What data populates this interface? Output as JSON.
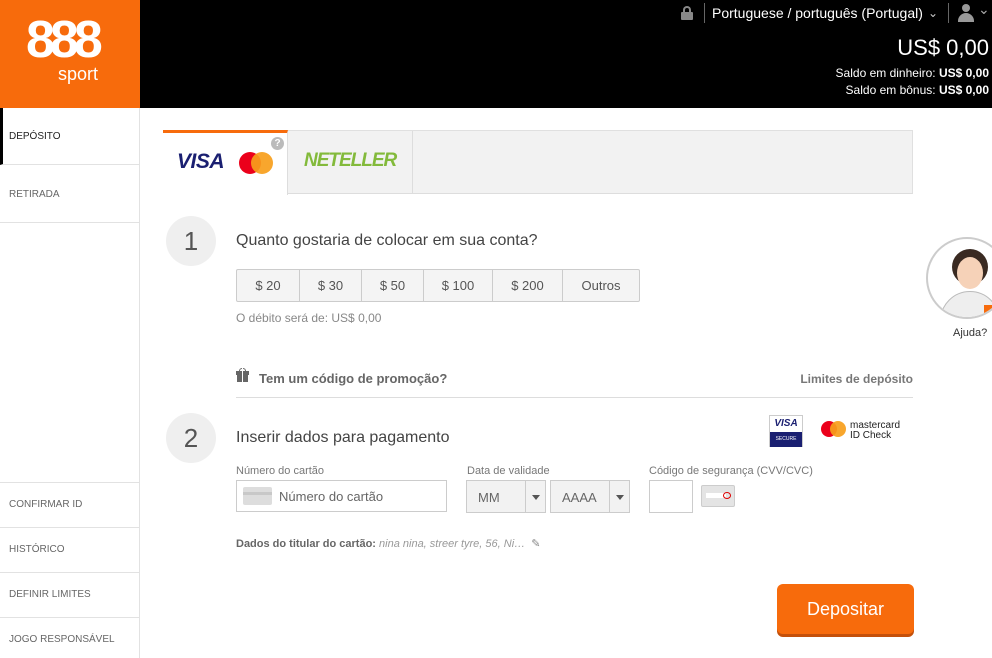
{
  "brand": {
    "logo_number": "888",
    "logo_sub": "sport",
    "accent_color": "#f76b0c"
  },
  "header": {
    "language": "Portuguese / português (Portugal)",
    "balance": "US$ 0,00",
    "cash_label": "Saldo em dinheiro:",
    "cash_value": "US$ 0,00",
    "bonus_label": "Saldo em bônus:",
    "bonus_value": "US$ 0,00"
  },
  "sidebar": {
    "items": [
      {
        "label": "DEPÓSITO",
        "active": true
      },
      {
        "label": "RETIRADA",
        "active": false
      }
    ],
    "lower": [
      {
        "label": "CONFIRMAR ID"
      },
      {
        "label": "HISTÓRICO"
      },
      {
        "label": "DEFINIR LIMITES"
      },
      {
        "label": "JOGO RESPONSÁVEL"
      }
    ]
  },
  "tabs": {
    "visa_label": "VISA",
    "help_glyph": "?",
    "neteller_label": "NETELLER"
  },
  "step1": {
    "number": "1",
    "title": "Quanto gostaria de colocar em sua conta?",
    "amounts": [
      "$ 20",
      "$ 30",
      "$ 50",
      "$ 100",
      "$ 200",
      "Outros"
    ],
    "debit_text": "O débito será de: US$ 0,00"
  },
  "promo": {
    "text": "Tem um código de promoção?",
    "limits_link": "Limites de depósito"
  },
  "step2": {
    "number": "2",
    "title": "Inserir dados para pagamento",
    "visa_secure_top": "VISA",
    "visa_secure_bottom": "SECURE",
    "mc_line1": "mastercard",
    "mc_line2": "ID Check",
    "card_number_label": "Número do cartão",
    "card_number_placeholder": "Número do cartão",
    "expiry_label": "Data de validade",
    "month_value": "MM",
    "year_value": "AAAA",
    "cvv_label": "Código de segurança (CVV/CVC)",
    "holder_label": "Dados do titular do cartão:",
    "holder_value": "nina nina, streer tyre, 56, Ni…"
  },
  "actions": {
    "deposit_label": "Depositar"
  },
  "help": {
    "label": "Ajuda?"
  },
  "icons": {
    "lock": "lock-icon",
    "chevron": "chevron-down-icon",
    "user": "user-icon",
    "gift": "gift-icon",
    "pencil": "pencil-icon",
    "card": "credit-card-icon"
  }
}
